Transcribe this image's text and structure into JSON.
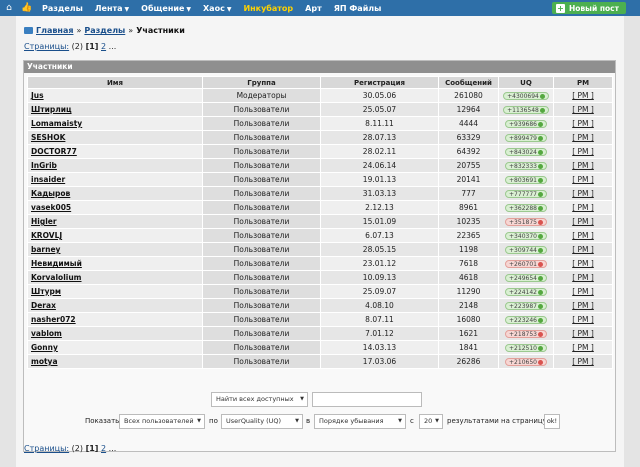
{
  "topnav": {
    "items": [
      "Разделы",
      "Лента",
      "Общение",
      "Хаос",
      "Инкубатор",
      "Арт",
      "ЯП Файлы"
    ],
    "new_post": "Новый пост"
  },
  "breadcrumb": {
    "home": "Главная",
    "section": "Разделы",
    "current": "Участники"
  },
  "pager": {
    "label": "Страницы:",
    "count": "(2)",
    "current": "[1]",
    "next": "2",
    "dots": "..."
  },
  "panel_title": "Участники",
  "columns": [
    "Имя",
    "Группа",
    "Регистрация",
    "Сообщений",
    "UQ",
    "PM"
  ],
  "rows": [
    {
      "name": "Jus",
      "group": "Модераторы",
      "reg": "30.05.06",
      "posts": "261080",
      "uq": "+4300694",
      "neg": false
    },
    {
      "name": "Штирлиц",
      "group": "Пользователи",
      "reg": "25.05.07",
      "posts": "12964",
      "uq": "+1136548",
      "neg": false
    },
    {
      "name": "Lomamaisty",
      "group": "Пользователи",
      "reg": "8.11.11",
      "posts": "4444",
      "uq": "+939686",
      "neg": false
    },
    {
      "name": "SESHOK",
      "group": "Пользователи",
      "reg": "28.07.13",
      "posts": "63329",
      "uq": "+899479",
      "neg": false
    },
    {
      "name": "DOCTOR77",
      "group": "Пользователи",
      "reg": "28.02.11",
      "posts": "64392",
      "uq": "+843024",
      "neg": false
    },
    {
      "name": "InGrib",
      "group": "Пользователи",
      "reg": "24.06.14",
      "posts": "20755",
      "uq": "+832333",
      "neg": false
    },
    {
      "name": "insaider",
      "group": "Пользователи",
      "reg": "19.01.13",
      "posts": "20141",
      "uq": "+803691",
      "neg": false
    },
    {
      "name": "Кадыров",
      "group": "Пользователи",
      "reg": "31.03.13",
      "posts": "777",
      "uq": "+777777",
      "neg": false
    },
    {
      "name": "vasek005",
      "group": "Пользователи",
      "reg": "2.12.13",
      "posts": "8961",
      "uq": "+362288",
      "neg": false
    },
    {
      "name": "Higler",
      "group": "Пользователи",
      "reg": "15.01.09",
      "posts": "10235",
      "uq": "+351875",
      "neg": true
    },
    {
      "name": "KROVLJ",
      "group": "Пользователи",
      "reg": "6.07.13",
      "posts": "22365",
      "uq": "+340370",
      "neg": false
    },
    {
      "name": "barney",
      "group": "Пользователи",
      "reg": "28.05.15",
      "posts": "1198",
      "uq": "+309744",
      "neg": false
    },
    {
      "name": "Невидимый",
      "group": "Пользователи",
      "reg": "23.01.12",
      "posts": "7618",
      "uq": "+260701",
      "neg": true
    },
    {
      "name": "Korvalolium",
      "group": "Пользователи",
      "reg": "10.09.13",
      "posts": "4618",
      "uq": "+249654",
      "neg": false
    },
    {
      "name": "Штурм",
      "group": "Пользователи",
      "reg": "25.09.07",
      "posts": "11290",
      "uq": "+224142",
      "neg": false
    },
    {
      "name": "Derax",
      "group": "Пользователи",
      "reg": "4.08.10",
      "posts": "2148",
      "uq": "+223987",
      "neg": false
    },
    {
      "name": "nasher072",
      "group": "Пользователи",
      "reg": "8.07.11",
      "posts": "16080",
      "uq": "+223246",
      "neg": false
    },
    {
      "name": "vablom",
      "group": "Пользователи",
      "reg": "7.01.12",
      "posts": "1621",
      "uq": "+218753",
      "neg": true
    },
    {
      "name": "Gonny",
      "group": "Пользователи",
      "reg": "14.03.13",
      "posts": "1841",
      "uq": "+212510",
      "neg": false
    },
    {
      "name": "motya",
      "group": "Пользователи",
      "reg": "17.03.06",
      "posts": "26286",
      "uq": "+210650",
      "neg": true
    }
  ],
  "pm_label": "[ PM ]",
  "search": {
    "find_all": "Найти всех доступных"
  },
  "filter": {
    "show_label": "Показать",
    "who": "Всех пользователей",
    "by": "по",
    "sort_field": "UserQuality (UQ)",
    "in": "в",
    "order": "Порядке убывания",
    "with": "с",
    "per_page": "20",
    "results_label": "результатами на страницу",
    "ok": "ok!"
  }
}
